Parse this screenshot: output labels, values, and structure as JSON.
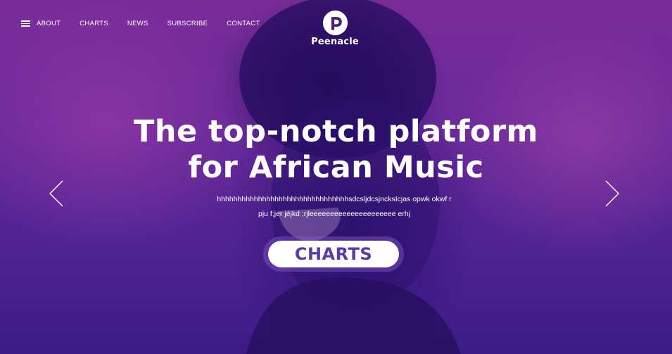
{
  "nav": {
    "items": [
      {
        "label": "ABOUT"
      },
      {
        "label": "CHARTS"
      },
      {
        "label": "NEWS"
      },
      {
        "label": "SUBSCRIBE"
      },
      {
        "label": "CONTACT"
      }
    ]
  },
  "logo": {
    "text": "Peenacle",
    "icon": "p-logo-icon"
  },
  "hero": {
    "headline_line1": "The top-notch platform",
    "headline_line2": "for African Music",
    "subtext_line1": "hhhhhhhhhhhhhhhhhhhhhhhhhhhhhhhhsdcsljdcsjncksIcjas opwk okwf  r",
    "subtext_line2": "pju f;jer jéjkd ;rjleeeeeeeeeeeeeeeeeeeee erhj",
    "cta_label": "CHARTS"
  },
  "icons": {
    "menu": "hamburger-menu-icon",
    "prev": "chevron-left-icon",
    "next": "chevron-right-icon"
  },
  "colors": {
    "overlay_purple": "#6a2a9a",
    "deep_indigo": "#3c1c86",
    "cta_text": "#5a3aa8",
    "text": "#ffffff"
  }
}
